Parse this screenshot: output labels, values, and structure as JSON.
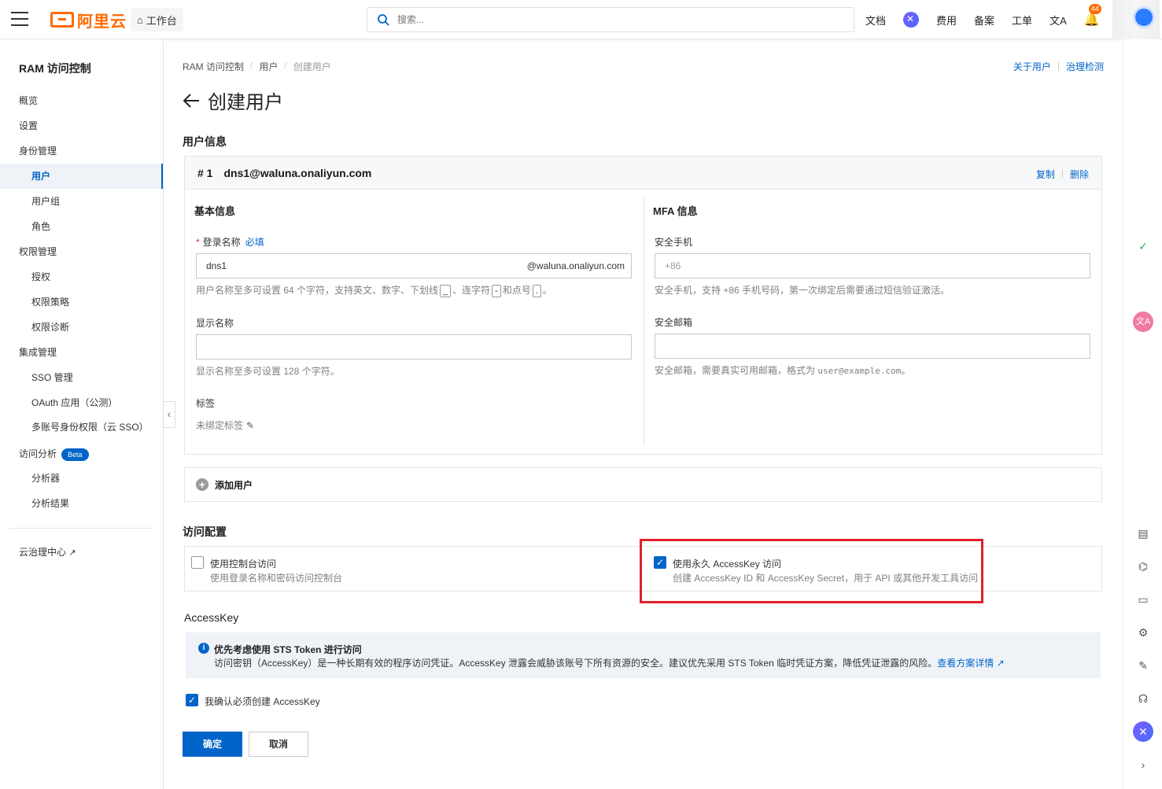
{
  "topbar": {
    "logo_text": "阿里云",
    "workbench": "工作台",
    "search_placeholder": "搜索...",
    "nav": [
      "文档",
      "费用",
      "备案",
      "工单"
    ],
    "notification_count": "44",
    "brand_color": "#ff6a00"
  },
  "sidebar": {
    "title": "RAM 访问控制",
    "items": [
      {
        "label": "概览",
        "level": 1
      },
      {
        "label": "设置",
        "level": 1
      },
      {
        "label": "身份管理",
        "level": 1
      },
      {
        "label": "用户",
        "level": 2,
        "active": true
      },
      {
        "label": "用户组",
        "level": 2
      },
      {
        "label": "角色",
        "level": 2
      },
      {
        "label": "权限管理",
        "level": 1
      },
      {
        "label": "授权",
        "level": 2
      },
      {
        "label": "权限策略",
        "level": 2
      },
      {
        "label": "权限诊断",
        "level": 2
      },
      {
        "label": "集成管理",
        "level": 1
      },
      {
        "label": "SSO 管理",
        "level": 2
      },
      {
        "label": "OAuth 应用（公测）",
        "level": 2
      },
      {
        "label": "多账号身份权限（云 SSO）",
        "level": 2
      },
      {
        "label": "访问分析",
        "level": 1,
        "badge": "Beta"
      },
      {
        "label": "分析器",
        "level": 2
      },
      {
        "label": "分析结果",
        "level": 2
      }
    ],
    "footer_link": "云治理中心"
  },
  "breadcrumb": [
    "RAM 访问控制",
    "用户",
    "创建用户"
  ],
  "toplinks": [
    "关于用户",
    "治理检测"
  ],
  "page_title": "创建用户",
  "user_info": {
    "section_title": "用户信息",
    "card_index": "# 1",
    "card_email": "dns1@waluna.onaliyun.com",
    "copy": "复制",
    "delete": "删除",
    "basic_title": "基本信息",
    "login_name_label": "登录名称",
    "required_link": "必填",
    "login_name_value": "dns1",
    "login_name_suffix": "@waluna.onaliyun.com",
    "login_hint_1": "用户名称至多可设置 64 个字符，支持英文、数字、下划线",
    "login_hint_2": "、连字符",
    "login_hint_3": "和点号",
    "login_hint_4": "。",
    "kbd_underscore": "_",
    "kbd_hyphen": "-",
    "kbd_dot": ".",
    "display_name_label": "显示名称",
    "display_name_value": "",
    "display_hint": "显示名称至多可设置 128 个字符。",
    "tags_label": "标签",
    "tags_value": "未绑定标签",
    "mfa_title": "MFA 信息",
    "phone_label": "安全手机",
    "phone_placeholder": "+86",
    "phone_hint": "安全手机，支持 +86 手机号码，第一次绑定后需要通过短信验证激活。",
    "email_label": "安全邮箱",
    "email_value": "",
    "email_hint_1": "安全邮箱，需要真实可用邮箱，格式为 ",
    "email_hint_code": "user@example.com",
    "email_hint_2": "。",
    "add_user": "添加用户"
  },
  "access": {
    "section_title": "访问配置",
    "console_title": "使用控制台访问",
    "console_desc": "使用登录名称和密码访问控制台",
    "console_checked": false,
    "ak_title": "使用永久 AccessKey 访问",
    "ak_desc": "创建 AccessKey ID 和 AccessKey Secret，用于 API 或其他开发工具访问",
    "ak_checked": true
  },
  "accesskey": {
    "section_title": "AccessKey",
    "notice_title": "优先考虑使用 STS Token 进行访问",
    "notice_text": "访问密钥（AccessKey）是一种长期有效的程序访问凭证。AccessKey 泄露会威胁该账号下所有资源的安全。建议优先采用 STS Token 临时凭证方案，降低凭证泄露的风险。",
    "notice_link": "查看方案详情",
    "confirm_label": "我确认必须创建 AccessKey",
    "confirm_checked": true
  },
  "actions": {
    "ok": "确定",
    "cancel": "取消"
  },
  "colors": {
    "primary": "#0064c8",
    "highlight_border": "#e0202a"
  }
}
